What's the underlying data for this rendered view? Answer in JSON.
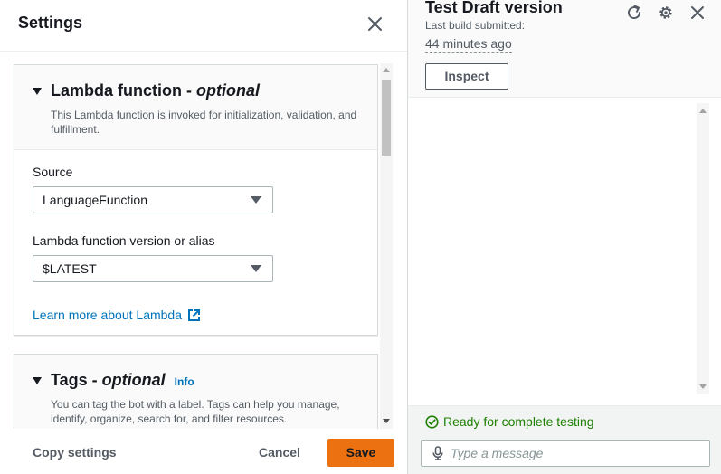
{
  "settings": {
    "title": "Settings",
    "lambda": {
      "title": "Lambda function - ",
      "title_optional": "optional",
      "description": "This Lambda function is invoked for initialization, validation, and fulfillment.",
      "source_label": "Source",
      "source_value": "LanguageFunction",
      "version_label": "Lambda function version or alias",
      "version_value": "$LATEST",
      "learn_more": "Learn more about Lambda"
    },
    "tags": {
      "title": "Tags - ",
      "title_optional": "optional",
      "info": "Info",
      "description": "You can tag the bot with a label. Tags can help you manage, identify, organize, search for, and filter resources."
    },
    "footer": {
      "copy": "Copy settings",
      "cancel": "Cancel",
      "save": "Save"
    },
    "colors": {
      "primary": "#ec7211",
      "link": "#0073bb"
    }
  },
  "test": {
    "title": "Test Draft version",
    "build_label": "Last build submitted:",
    "build_time": "44 minutes ago",
    "inspect": "Inspect",
    "status": "Ready for complete testing",
    "message_placeholder": "Type a message",
    "colors": {
      "success": "#1d8102"
    }
  }
}
